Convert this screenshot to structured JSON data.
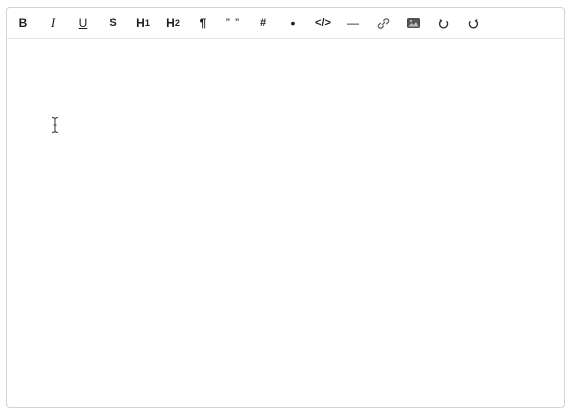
{
  "toolbar": {
    "bold": "B",
    "italic": "I",
    "underline": "U",
    "strike": "S",
    "h1": "H",
    "h1_sub": "1",
    "h2": "H",
    "h2_sub": "2",
    "paragraph": "¶",
    "blockquote": "” ”",
    "hash": "#",
    "bullet": "•",
    "code": "</>",
    "hr": "—"
  },
  "icons": {
    "link": "link-icon",
    "image": "image-icon",
    "undo": "undo-icon",
    "redo": "redo-icon",
    "cursor": "text-cursor-icon"
  },
  "colors": {
    "text": "#1f1f1f",
    "border": "#d4d4d4"
  }
}
